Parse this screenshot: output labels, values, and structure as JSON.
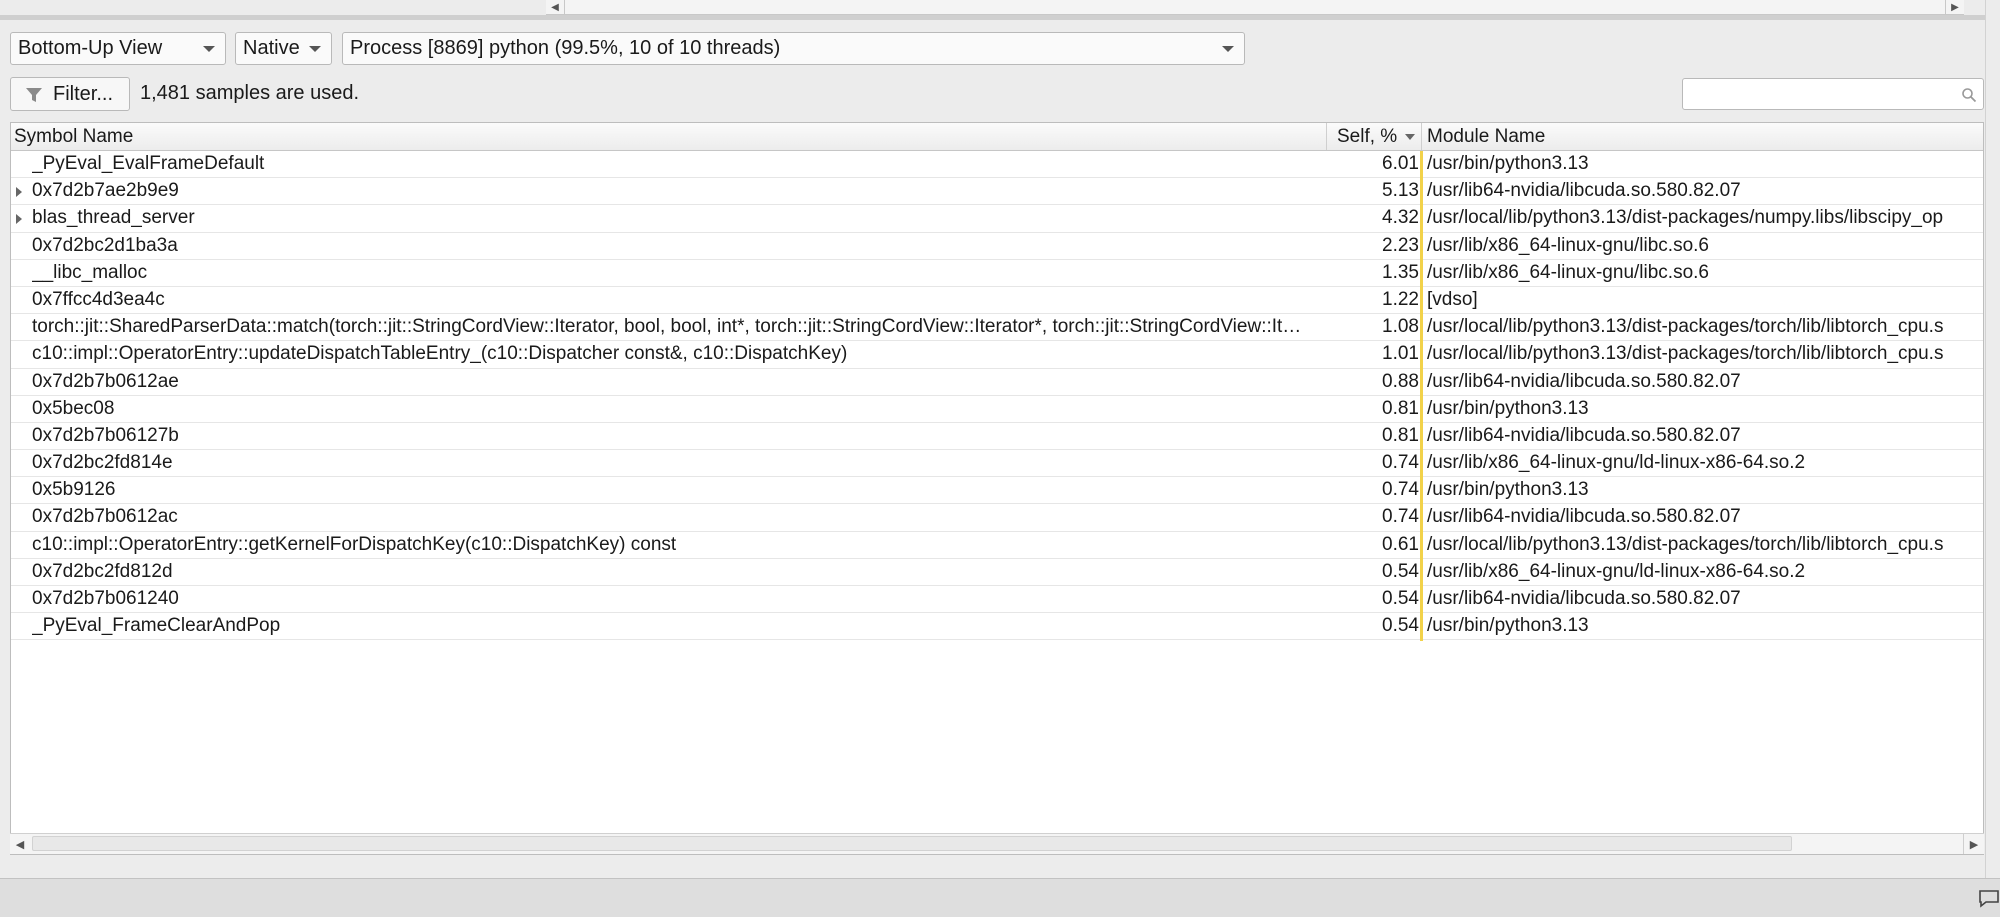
{
  "toolbar": {
    "view_select": "Bottom-Up View",
    "mode_select": "Native",
    "process_select": "Process [8869] python (99.5%, 10 of 10 threads)",
    "filter_button": "Filter...",
    "samples_text": "1,481 samples are used.",
    "search_value": ""
  },
  "table": {
    "columns": {
      "symbol": "Symbol Name",
      "self": "Self, %",
      "module": "Module Name"
    },
    "rows": [
      {
        "symbol": "_PyEval_EvalFrameDefault",
        "self": "6.01",
        "module": "/usr/bin/python3.13",
        "expandable": false
      },
      {
        "symbol": "0x7d2b7ae2b9e9",
        "self": "5.13",
        "module": "/usr/lib64-nvidia/libcuda.so.580.82.07",
        "expandable": true
      },
      {
        "symbol": "blas_thread_server",
        "self": "4.32",
        "module": "/usr/local/lib/python3.13/dist-packages/numpy.libs/libscipy_op",
        "expandable": true
      },
      {
        "symbol": "0x7d2bc2d1ba3a",
        "self": "2.23",
        "module": "/usr/lib/x86_64-linux-gnu/libc.so.6",
        "expandable": false
      },
      {
        "symbol": "__libc_malloc",
        "self": "1.35",
        "module": "/usr/lib/x86_64-linux-gnu/libc.so.6",
        "expandable": false
      },
      {
        "symbol": "0x7ffcc4d3ea4c",
        "self": "1.22",
        "module": "[vdso]",
        "expandable": false
      },
      {
        "symbol": "torch::jit::SharedParserData::match(torch::jit::StringCordView::Iterator, bool, bool, int*, torch::jit::StringCordView::Iterator*, torch::jit::StringCordView::It…",
        "self": "1.08",
        "module": "/usr/local/lib/python3.13/dist-packages/torch/lib/libtorch_cpu.s",
        "expandable": false
      },
      {
        "symbol": "c10::impl::OperatorEntry::updateDispatchTableEntry_(c10::Dispatcher const&, c10::DispatchKey)",
        "self": "1.01",
        "module": "/usr/local/lib/python3.13/dist-packages/torch/lib/libtorch_cpu.s",
        "expandable": false
      },
      {
        "symbol": "0x7d2b7b0612ae",
        "self": "0.88",
        "module": "/usr/lib64-nvidia/libcuda.so.580.82.07",
        "expandable": false
      },
      {
        "symbol": "0x5bec08",
        "self": "0.81",
        "module": "/usr/bin/python3.13",
        "expandable": false
      },
      {
        "symbol": "0x7d2b7b06127b",
        "self": "0.81",
        "module": "/usr/lib64-nvidia/libcuda.so.580.82.07",
        "expandable": false
      },
      {
        "symbol": "0x7d2bc2fd814e",
        "self": "0.74",
        "module": "/usr/lib/x86_64-linux-gnu/ld-linux-x86-64.so.2",
        "expandable": false
      },
      {
        "symbol": "0x5b9126",
        "self": "0.74",
        "module": "/usr/bin/python3.13",
        "expandable": false
      },
      {
        "symbol": "0x7d2b7b0612ac",
        "self": "0.74",
        "module": "/usr/lib64-nvidia/libcuda.so.580.82.07",
        "expandable": false
      },
      {
        "symbol": "c10::impl::OperatorEntry::getKernelForDispatchKey(c10::DispatchKey) const",
        "self": "0.61",
        "module": "/usr/local/lib/python3.13/dist-packages/torch/lib/libtorch_cpu.s",
        "expandable": false
      },
      {
        "symbol": "0x7d2bc2fd812d",
        "self": "0.54",
        "module": "/usr/lib/x86_64-linux-gnu/ld-linux-x86-64.so.2",
        "expandable": false
      },
      {
        "symbol": "0x7d2b7b061240",
        "self": "0.54",
        "module": "/usr/lib64-nvidia/libcuda.so.580.82.07",
        "expandable": false
      },
      {
        "symbol": "_PyEval_FrameClearAndPop",
        "self": "0.54",
        "module": "/usr/bin/python3.13",
        "expandable": false
      }
    ]
  },
  "icons": {
    "filter": "funnel-icon",
    "search": "search-icon",
    "sort": "sort-descending-icon",
    "status": "chat-bubble-icon"
  },
  "colors": {
    "highlight_line": "#f2d24a"
  }
}
